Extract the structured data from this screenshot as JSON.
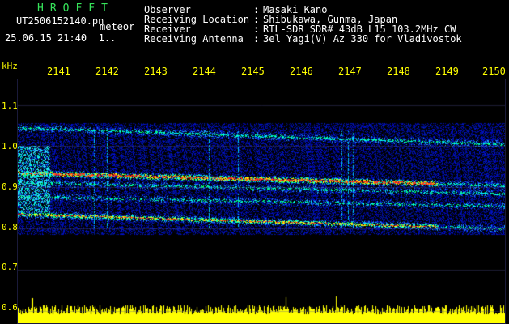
{
  "app": {
    "name": "HROFFT"
  },
  "file": {
    "name": "UT2506152140.pn",
    "mode": "meteor",
    "stamp": "25.06.15 21:40",
    "page": "1.."
  },
  "meta": [
    {
      "key": "Observer",
      "value": "Masaki Kano"
    },
    {
      "key": "Receiving Location",
      "value": "Shibukawa, Gunma, Japan"
    },
    {
      "key": "Receiver",
      "value": "RTL-SDR SDR# 43dB L15 103.2MHz CW"
    },
    {
      "key": "Receiving Antenna",
      "value": "3el Yagi(V) Az 330 for Vladivostok"
    }
  ],
  "axes": {
    "y_unit": "kHz",
    "x_ticks": [
      "2141",
      "2142",
      "2143",
      "2144",
      "2145",
      "2146",
      "2147",
      "2148",
      "2149",
      "2150"
    ],
    "y_ticks": [
      "1.1",
      "1.0",
      "0.9",
      "0.8",
      "0.7",
      "0.6"
    ]
  },
  "colors": {
    "background": "#000000",
    "accent_green": "#36e35a",
    "axis_label": "#ffff00",
    "noise_blue": "#1a2ae0",
    "signal_red": "#ff2020",
    "signal_yellow": "#ffff00",
    "signal_cyan": "#00ffff"
  },
  "chart_data": {
    "type": "heatmap",
    "title": "",
    "xlabel": "",
    "ylabel": "kHz",
    "x_range": [
      2140,
      2150
    ],
    "y_range": [
      0.58,
      1.15
    ],
    "traces": [
      {
        "f_start": 1.045,
        "f_end": 1.005,
        "strength": 0.55
      },
      {
        "f_start": 0.935,
        "f_end": 0.905,
        "strength": 1.0
      },
      {
        "f_start": 0.912,
        "f_end": 0.885,
        "strength": 0.5
      },
      {
        "f_start": 0.878,
        "f_end": 0.855,
        "strength": 0.45
      },
      {
        "f_start": 0.835,
        "f_end": 0.8,
        "strength": 0.85
      }
    ]
  }
}
